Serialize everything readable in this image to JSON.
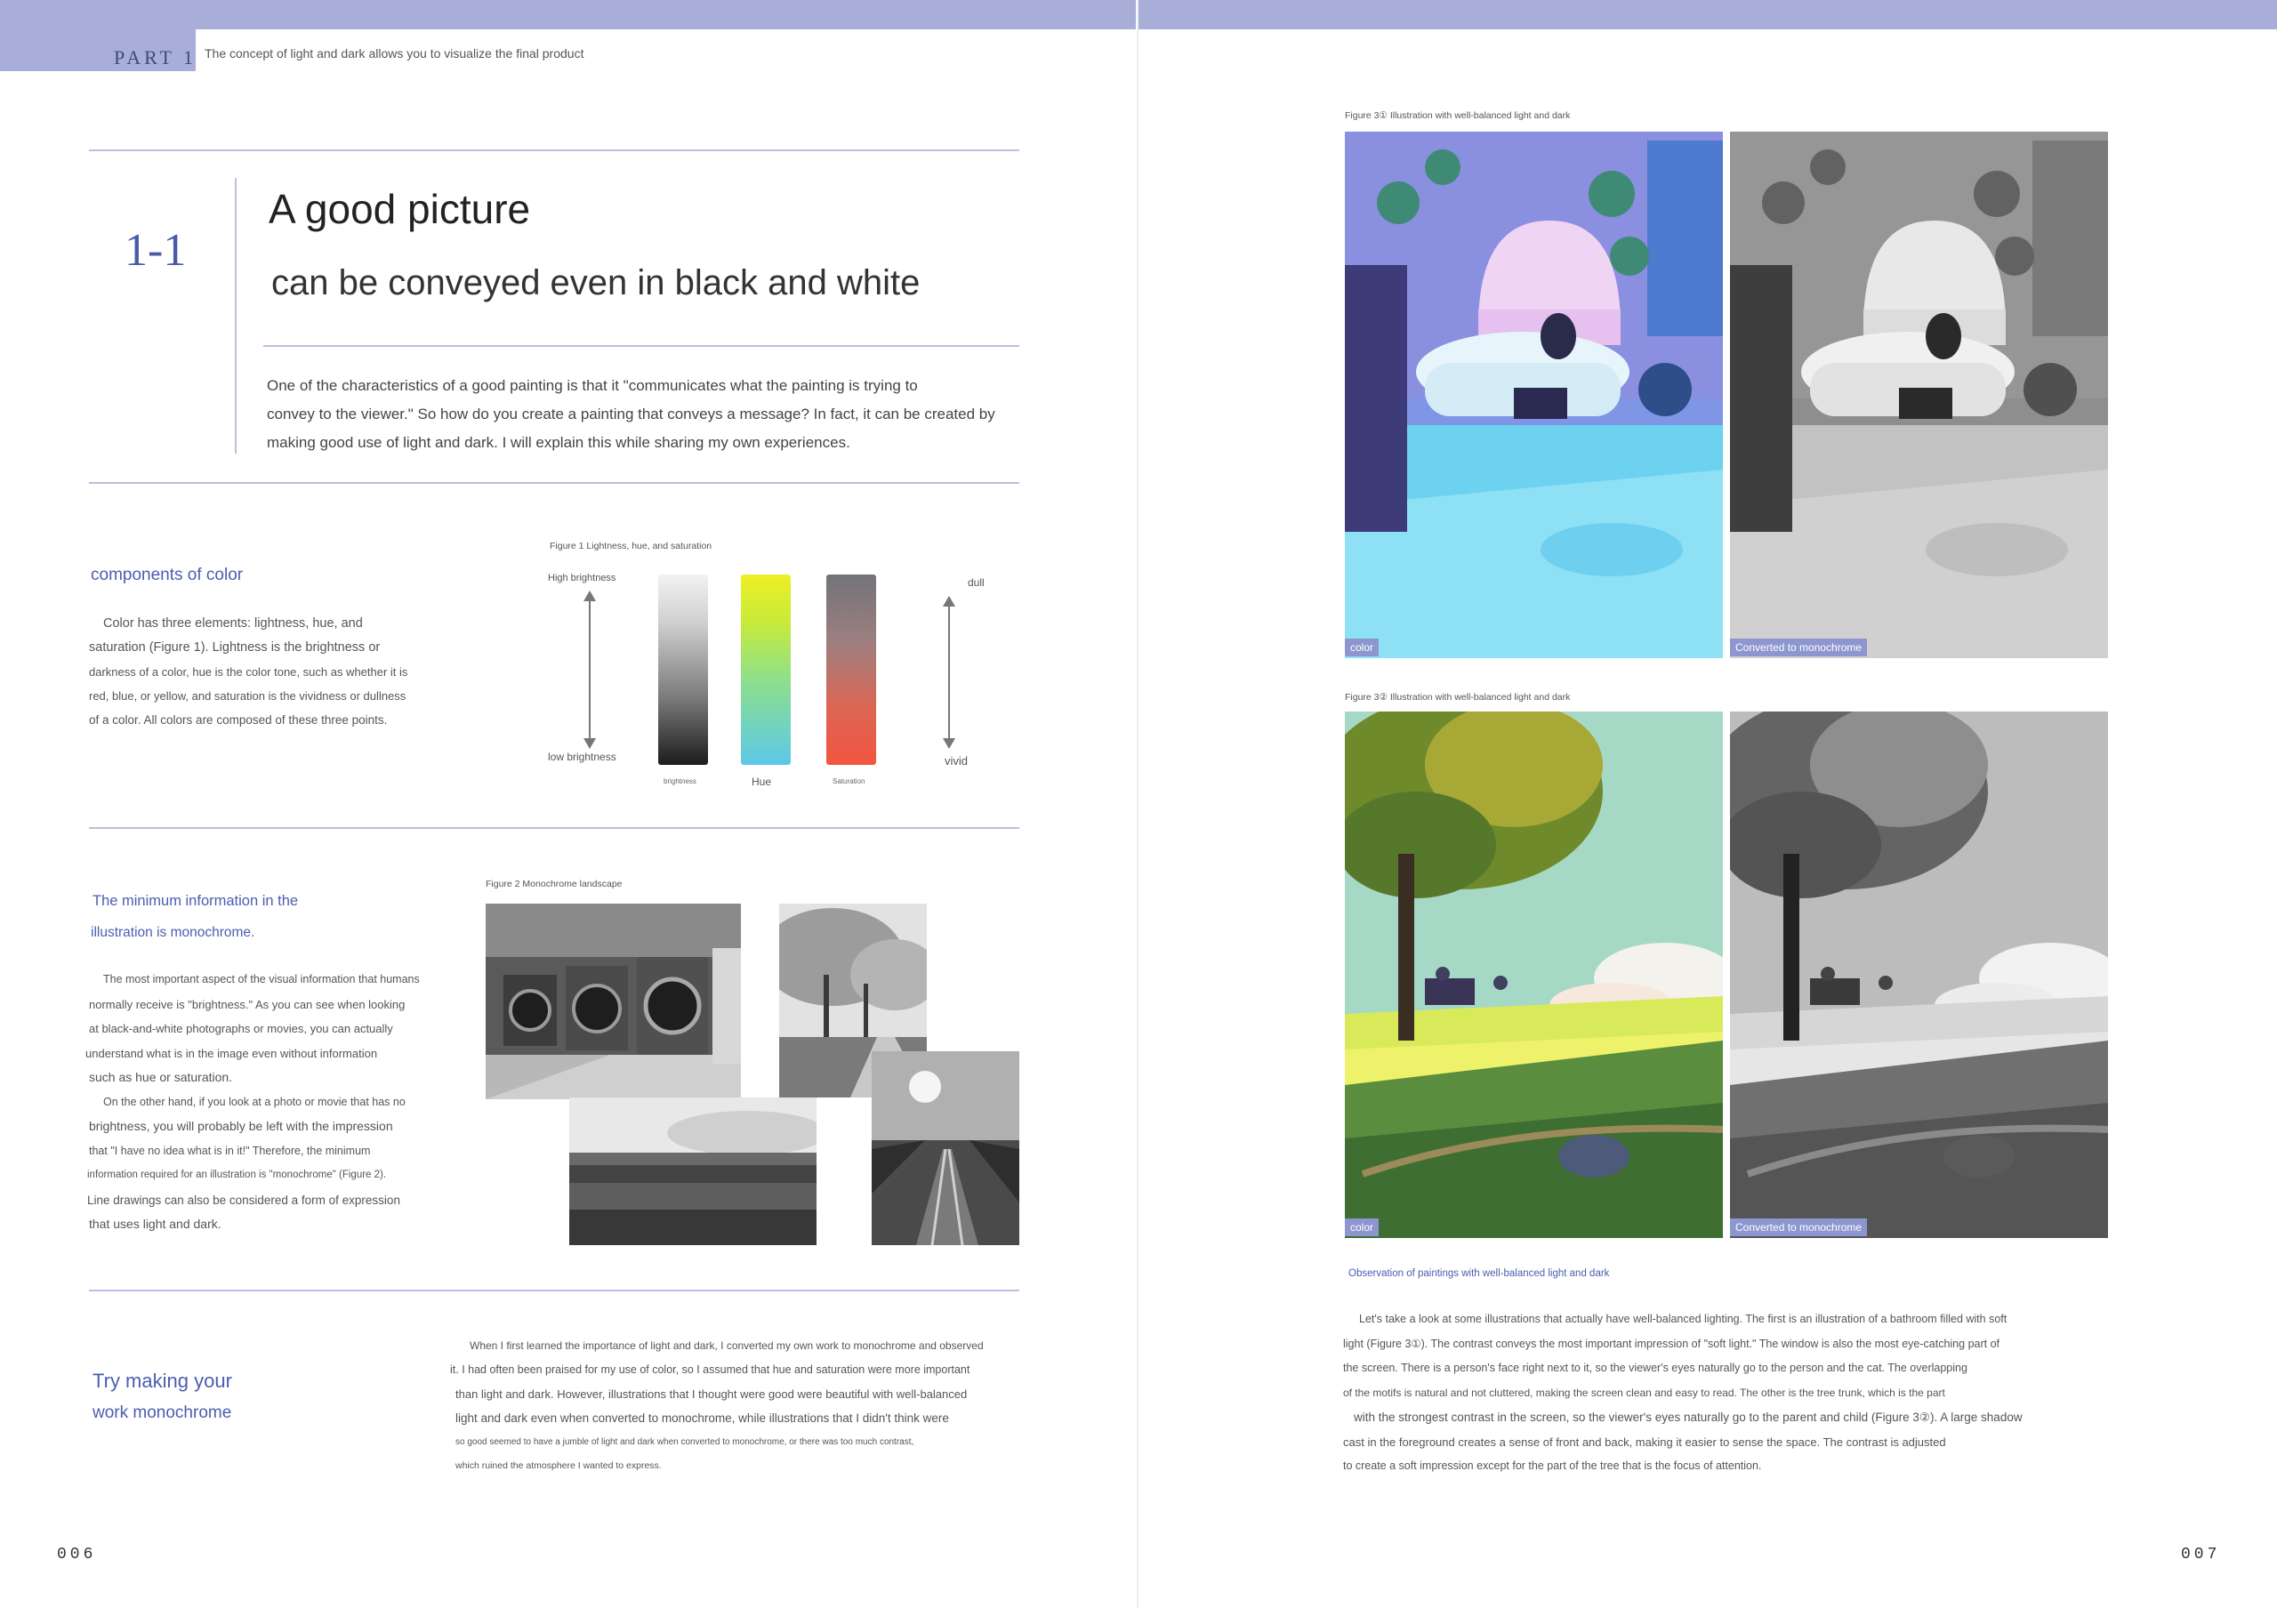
{
  "header": {
    "part_label": "PART 1",
    "part_subtitle": "The concept of light and dark allows you to visualize the final product"
  },
  "section": {
    "number": "1-1",
    "title": "A good picture",
    "subtitle": "can be conveyed even in black and white",
    "intro": [
      "One of the characteristics of a good painting is that it \"communicates what the painting is trying to",
      "convey to the viewer.\" So how do you create a painting that conveys a message? In fact, it can be created by",
      "making good use of light and dark. I will explain this while sharing my own experiences."
    ]
  },
  "components": {
    "title": "components of color",
    "body": [
      "Color has three elements: lightness, hue, and",
      "saturation (Figure 1). Lightness is the brightness or",
      "darkness of a color, hue is the color tone, such as whether it is",
      "red, blue, or yellow, and saturation is the vividness or dullness",
      "of a color. All colors are composed of these three points."
    ]
  },
  "figure1": {
    "caption": "Figure 1 Lightness, hue, and saturation",
    "high_label": "High brightness",
    "low_label": "low brightness",
    "dull_label": "dull",
    "vivid_label": "vivid",
    "brightness_label": "brightness",
    "hue_label": "Hue",
    "saturation_label": "Saturation"
  },
  "minimum": {
    "title_line1": "The minimum information in the",
    "title_line2": "illustration is monochrome.",
    "body": [
      "The most important aspect of the visual information that humans",
      "normally receive is \"brightness.\" As you can see when looking",
      "at black-and-white photographs or movies, you can actually",
      "understand what is in the image even without information",
      "such as hue or saturation.",
      "On the other hand, if you look at a photo or movie that has no",
      "brightness, you will probably be left with the impression",
      "that \"I have no idea what is in it!\" Therefore, the minimum",
      "information required for an illustration is \"monochrome\" (Figure 2).",
      "Line drawings can also be considered a form of expression",
      "that uses light and dark."
    ]
  },
  "figure2": {
    "caption": "Figure 2 Monochrome landscape"
  },
  "try": {
    "title_line1": "Try making your",
    "title_line2": "work monochrome",
    "body": [
      "When I first learned the importance of light and dark, I converted my own work to monochrome and observed",
      "it. I had often been praised for my use of color, so I assumed that hue and saturation were more important",
      "than light and dark. However, illustrations that I thought were good were beautiful with well-balanced",
      "light and dark even when converted to monochrome, while illustrations that I didn't think were",
      "so good seemed to have a jumble of light and dark when converted to monochrome, or there was too much contrast,",
      "which ruined the atmosphere I wanted to express."
    ]
  },
  "figure31": {
    "caption": "Figure 3① Illustration with well-balanced light and dark",
    "color_badge": "color",
    "mono_badge": "Converted to monochrome"
  },
  "figure32": {
    "caption": "Figure 3② Illustration with well-balanced light and dark",
    "color_badge": "color",
    "mono_badge": "Converted to monochrome"
  },
  "observation": {
    "title": "Observation of paintings with well-balanced light and dark",
    "body": [
      "Let's take a look at some illustrations that actually have well-balanced lighting. The first is an illustration of a bathroom filled with soft",
      "light (Figure 3①). The contrast conveys the most important impression of \"soft light.\" The window is also the most eye-catching part of",
      "the screen. There is a person's face right next to it, so the viewer's eyes naturally go to the person and the cat. The overlapping",
      "of the motifs is natural and not cluttered, making the screen clean and easy to read. The other is the tree trunk, which is the part",
      "with the strongest contrast in the screen, so the viewer's eyes naturally go to the parent and child (Figure 3②). A large shadow",
      "cast in the foreground creates a sense of front and back, making it easier to sense the space. The contrast is adjusted",
      "to create a soft impression except for the part of the tree that is the focus of attention."
    ]
  },
  "pages": {
    "left": "006",
    "right": "007"
  },
  "colors": {
    "accent": "#4a5eb0",
    "band": "#a8aed8",
    "rule": "#b9bfe0"
  }
}
